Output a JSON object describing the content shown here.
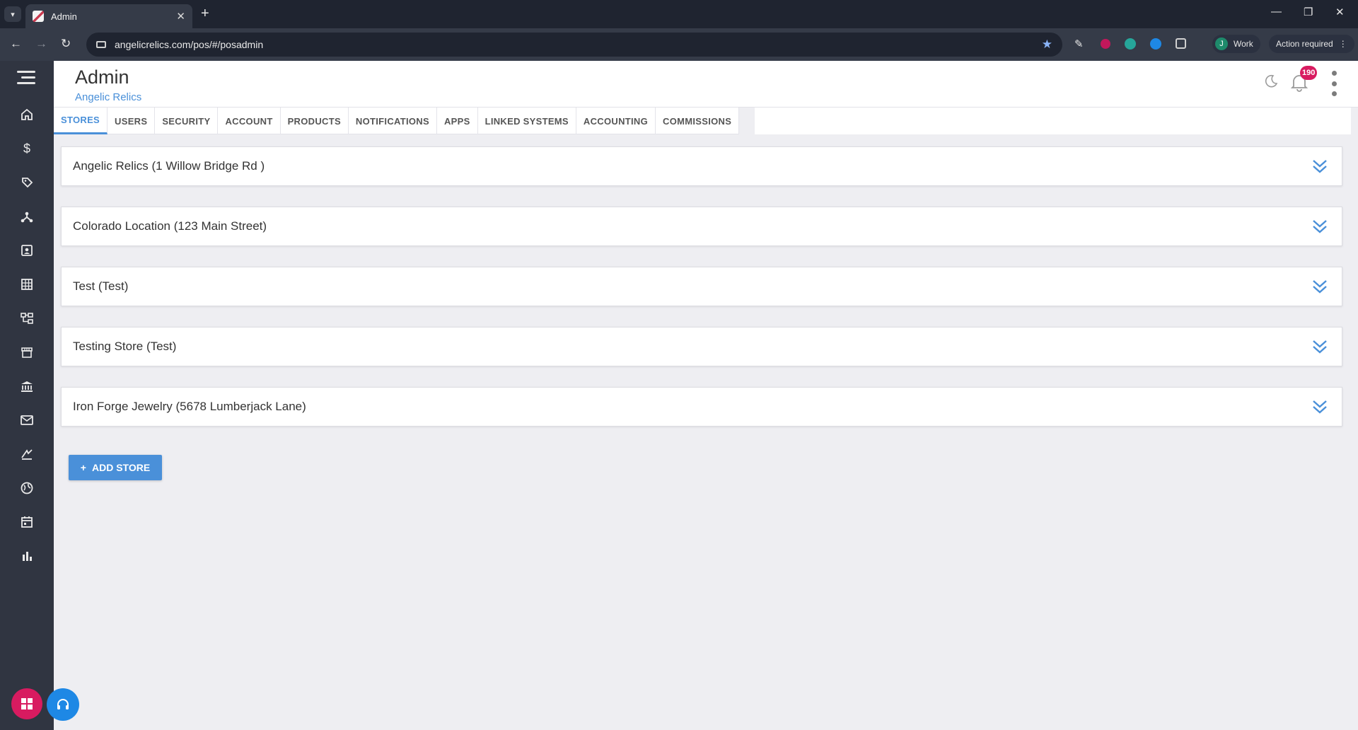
{
  "browser": {
    "tab_title": "Admin",
    "url": "angelicrelics.com/pos/#/posadmin",
    "profile_initial": "J",
    "profile_label": "Work",
    "action_label": "Action required"
  },
  "header": {
    "title": "Admin",
    "subtitle": "Angelic Relics",
    "notification_count": "190"
  },
  "tabs": [
    {
      "label": "STORES",
      "active": true
    },
    {
      "label": "USERS"
    },
    {
      "label": "SECURITY"
    },
    {
      "label": "ACCOUNT"
    },
    {
      "label": "PRODUCTS"
    },
    {
      "label": "NOTIFICATIONS"
    },
    {
      "label": "APPS"
    },
    {
      "label": "LINKED SYSTEMS"
    },
    {
      "label": "ACCOUNTING"
    },
    {
      "label": "COMMISSIONS"
    }
  ],
  "stores": [
    {
      "name": "Angelic Relics (1 Willow Bridge Rd )"
    },
    {
      "name": "Colorado Location (123 Main Street)"
    },
    {
      "name": "Test (Test)"
    },
    {
      "name": "Testing Store (Test)"
    },
    {
      "name": "Iron Forge Jewelry (5678 Lumberjack Lane)"
    }
  ],
  "add_store_label": "ADD STORE",
  "sidebar_icons": [
    "home-icon",
    "dollar-icon",
    "tag-icon",
    "network-icon",
    "contacts-icon",
    "building-icon",
    "hierarchy-icon",
    "store-icon",
    "bank-icon",
    "mail-icon",
    "promotions-icon",
    "globe-icon",
    "calendar-icon",
    "reports-icon"
  ],
  "colors": {
    "accent": "#4a90d9",
    "sidebar": "#303541",
    "badge": "#d81b60"
  }
}
